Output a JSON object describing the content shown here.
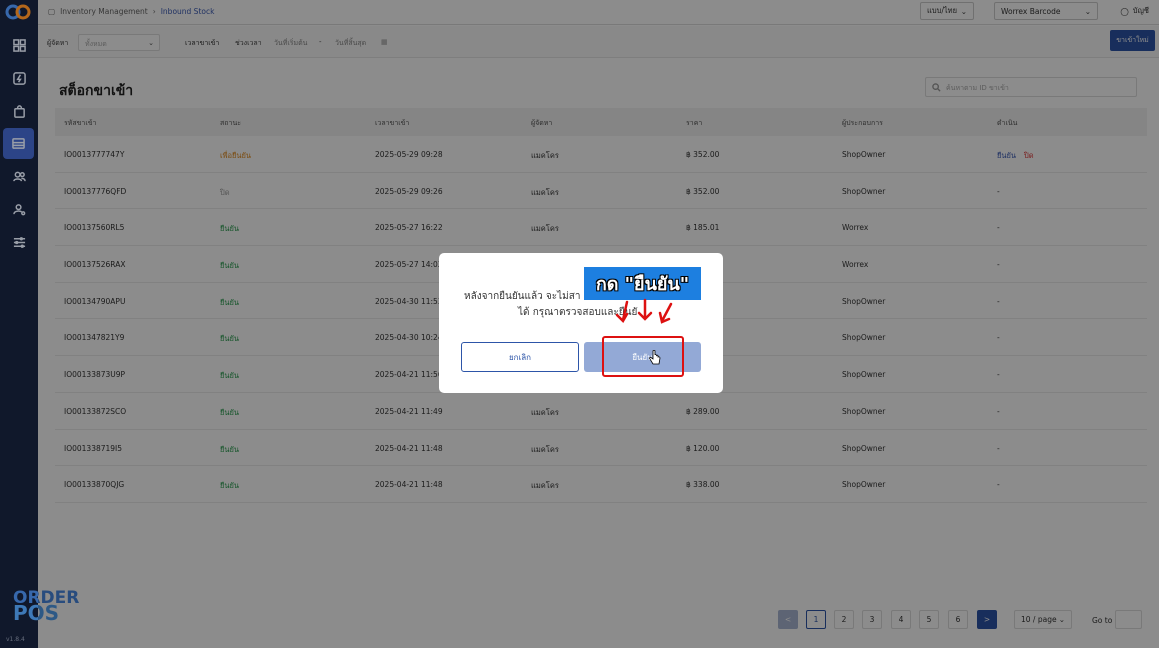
{
  "breadcrumb": {
    "root": "Inventory Management",
    "current": "Inbound Stock"
  },
  "topbar": {
    "language": "แบบ/ไทย",
    "company": "Worrex Barcode",
    "user": "บัญชี"
  },
  "filters": {
    "supplier_label": "ผู้จัดหา",
    "supplier_placeholder": "ทั้งหมด",
    "time_label": "เวลาขาเข้า",
    "range_label": "ช่วงเวลา",
    "start_placeholder": "วันที่เริ่มต้น",
    "sep": "-",
    "end_placeholder": "วันที่สิ้นสุด",
    "new_button": "ขาเข้าใหม่"
  },
  "page": {
    "title": "สต็อกขาเข้า",
    "search_placeholder": "ค้นหาตาม ID ขาเข้า"
  },
  "table": {
    "headers": [
      "รหัสขาเข้า",
      "สถานะ",
      "เวลาขาเข้า",
      "ผู้จัดหา",
      "ราคา",
      "ผู้ประกอบการ",
      "ดำเนิน"
    ],
    "rows": [
      {
        "id": "IO0013777747Y",
        "status": "เพื่อยืนยัน",
        "status_type": "orange",
        "time": "2025-05-29 09:28",
        "supplier": "แมคโคร",
        "price": "฿ 352.00",
        "operator": "ShopOwner",
        "action": "",
        "confirm": "ยืนยัน",
        "close": "ปิด"
      },
      {
        "id": "IO00137776QFD",
        "status": "ปิด",
        "status_type": "gray",
        "time": "2025-05-29 09:26",
        "supplier": "แมคโคร",
        "price": "฿ 352.00",
        "operator": "ShopOwner",
        "action": "-"
      },
      {
        "id": "IO00137560RL5",
        "status": "ยืนยัน",
        "status_type": "green",
        "time": "2025-05-27 16:22",
        "supplier": "แมคโคร",
        "price": "฿ 185.01",
        "operator": "Worrex",
        "action": "-"
      },
      {
        "id": "IO00137526RAX",
        "status": "ยืนยัน",
        "status_type": "green",
        "time": "2025-05-27 14:02",
        "supplier": "",
        "price": "",
        "operator": "Worrex",
        "action": "-"
      },
      {
        "id": "IO00134790APU",
        "status": "ยืนยัน",
        "status_type": "green",
        "time": "2025-04-30 11:53",
        "supplier": "",
        "price": "",
        "operator": "ShopOwner",
        "action": "-"
      },
      {
        "id": "IO001347821Y9",
        "status": "ยืนยัน",
        "status_type": "green",
        "time": "2025-04-30 10:24",
        "supplier": "",
        "price": "",
        "operator": "ShopOwner",
        "action": "-"
      },
      {
        "id": "IO00133873U9P",
        "status": "ยืนยัน",
        "status_type": "green",
        "time": "2025-04-21 11:56",
        "supplier": "",
        "price": "",
        "operator": "ShopOwner",
        "action": "-"
      },
      {
        "id": "IO00133872SCO",
        "status": "ยืนยัน",
        "status_type": "green",
        "time": "2025-04-21 11:49",
        "supplier": "แมคโคร",
        "price": "฿ 289.00",
        "operator": "ShopOwner",
        "action": "-"
      },
      {
        "id": "IO001338719I5",
        "status": "ยืนยัน",
        "status_type": "green",
        "time": "2025-04-21 11:48",
        "supplier": "แมคโคร",
        "price": "฿ 120.00",
        "operator": "ShopOwner",
        "action": "-"
      },
      {
        "id": "IO00133870QJG",
        "status": "ยืนยัน",
        "status_type": "green",
        "time": "2025-04-21 11:48",
        "supplier": "แมคโคร",
        "price": "฿ 338.00",
        "operator": "ShopOwner",
        "action": "-"
      }
    ]
  },
  "pagination": {
    "pages": [
      "1",
      "2",
      "3",
      "4",
      "5",
      "6"
    ],
    "current": "1",
    "page_size": "10 / page",
    "goto_label": "Go to",
    "prev": "<",
    "next": ">"
  },
  "modal": {
    "line1": "หลังจากยืนยันแล้ว จะไม่สา",
    "line2": "ได้ กรุณาตรวจสอบและยืนยั",
    "cancel": "ยกเลิก",
    "confirm": "ยืนยัน"
  },
  "annotation": {
    "banner": "กด \"ยืนยัน\""
  },
  "brand": {
    "line1": "ORDER",
    "line2": "POS",
    "version": "v1.8.4"
  },
  "colors": {
    "primary": "#2d55a8",
    "sidebar": "#16213a",
    "confirmed": "#2a9d4f",
    "pending": "#e08a1e",
    "highlight": "#d11"
  }
}
